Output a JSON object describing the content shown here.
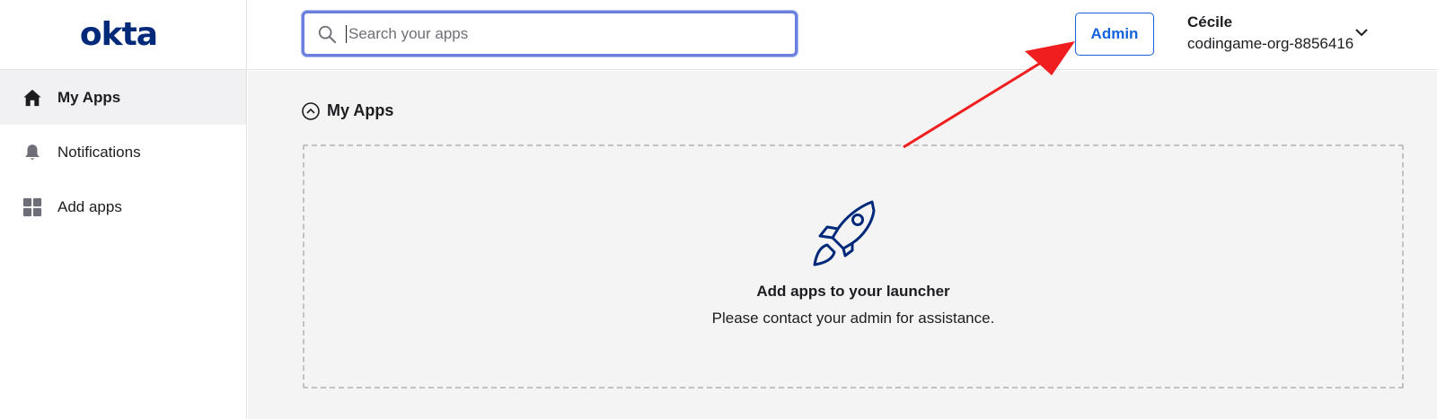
{
  "brand": {
    "logo_text": "okta"
  },
  "sidebar": {
    "items": [
      {
        "label": "My Apps",
        "icon": "home-icon",
        "active": true
      },
      {
        "label": "Notifications",
        "icon": "bell-icon",
        "active": false
      },
      {
        "label": "Add apps",
        "icon": "grid-icon",
        "active": false
      }
    ]
  },
  "header": {
    "search_placeholder": "Search your apps",
    "search_value": "",
    "admin_label": "Admin",
    "user_name": "Cécile",
    "user_org": "codingame-org-8856416"
  },
  "main": {
    "section_title": "My Apps",
    "empty_title": "Add apps to your launcher",
    "empty_subtitle": "Please contact your admin for assistance."
  },
  "colors": {
    "brand": "#00297a",
    "accent": "#1662dd",
    "annotation_arrow": "#f01e1e"
  }
}
